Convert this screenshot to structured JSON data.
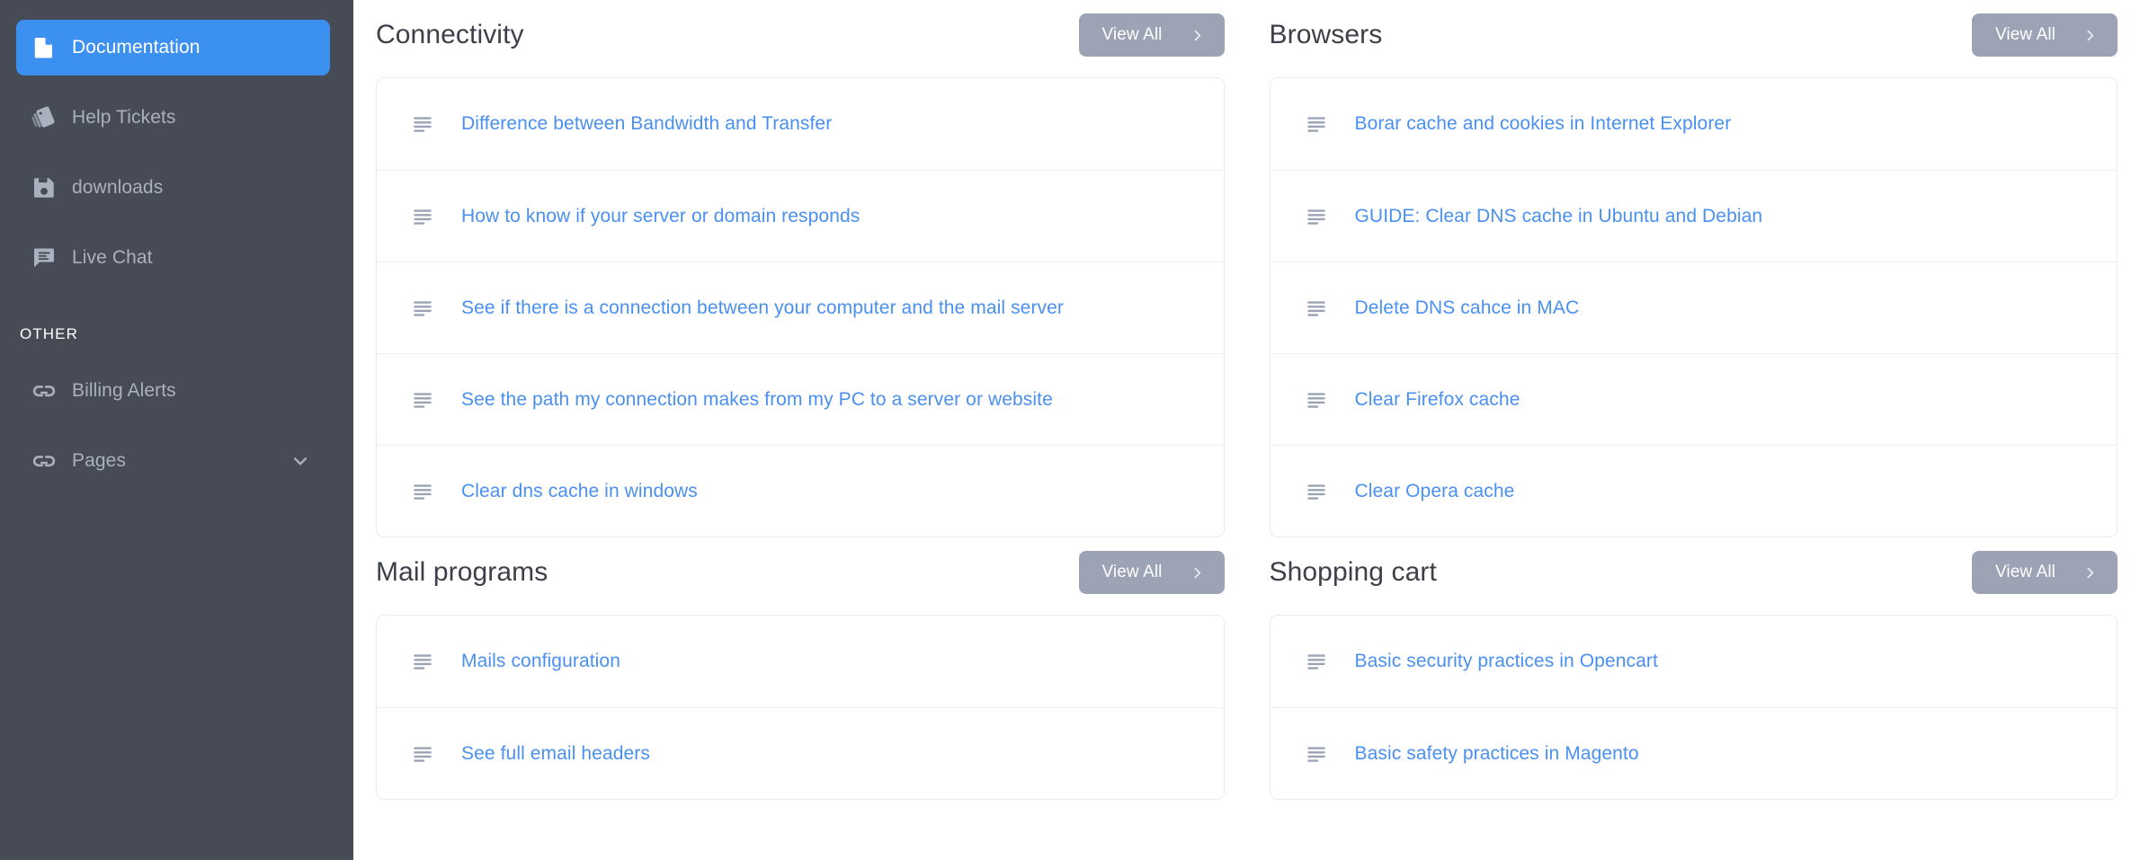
{
  "sidebar": {
    "items": [
      {
        "label": "Documentation",
        "icon": "document-icon",
        "active": true,
        "chevron": false
      },
      {
        "label": "Help Tickets",
        "icon": "tags-icon",
        "active": false,
        "chevron": false
      },
      {
        "label": "downloads",
        "icon": "floppy-disk-icon",
        "active": false,
        "chevron": false
      },
      {
        "label": "Live Chat",
        "icon": "chat-bubble-icon",
        "active": false,
        "chevron": false
      }
    ],
    "section_label": "OTHER",
    "other_items": [
      {
        "label": "Billing Alerts",
        "icon": "link-icon",
        "active": false,
        "chevron": false
      },
      {
        "label": "Pages",
        "icon": "link-icon",
        "active": false,
        "chevron": true
      }
    ],
    "colors": {
      "background": "#474b56",
      "active_background": "#3c90ef",
      "label": "#aab0bd",
      "active_label": "#ffffff"
    }
  },
  "main": {
    "view_all_label": "View All",
    "colors": {
      "link": "#4a90f0",
      "button": "#9ca3b5",
      "title": "#3d4049",
      "card_border": "#e8eaef"
    },
    "panels": [
      {
        "title": "Connectivity",
        "items": [
          "Difference between Bandwidth and Transfer",
          "How to know if your server or domain responds",
          "See if there is a connection between your computer and the mail server",
          "See the path my connection makes from my PC to a server or website",
          "Clear dns cache in windows"
        ]
      },
      {
        "title": "Browsers",
        "items": [
          "Borar cache and cookies in Internet Explorer",
          "GUIDE: Clear DNS cache in Ubuntu and Debian",
          "Delete DNS cahce in MAC",
          "Clear Firefox cache",
          "Clear Opera cache"
        ]
      },
      {
        "title": "Mail programs",
        "items": [
          "Mails configuration",
          "See full email headers"
        ]
      },
      {
        "title": "Shopping cart",
        "items": [
          "Basic security practices in Opencart",
          "Basic safety practices in Magento"
        ]
      }
    ]
  }
}
